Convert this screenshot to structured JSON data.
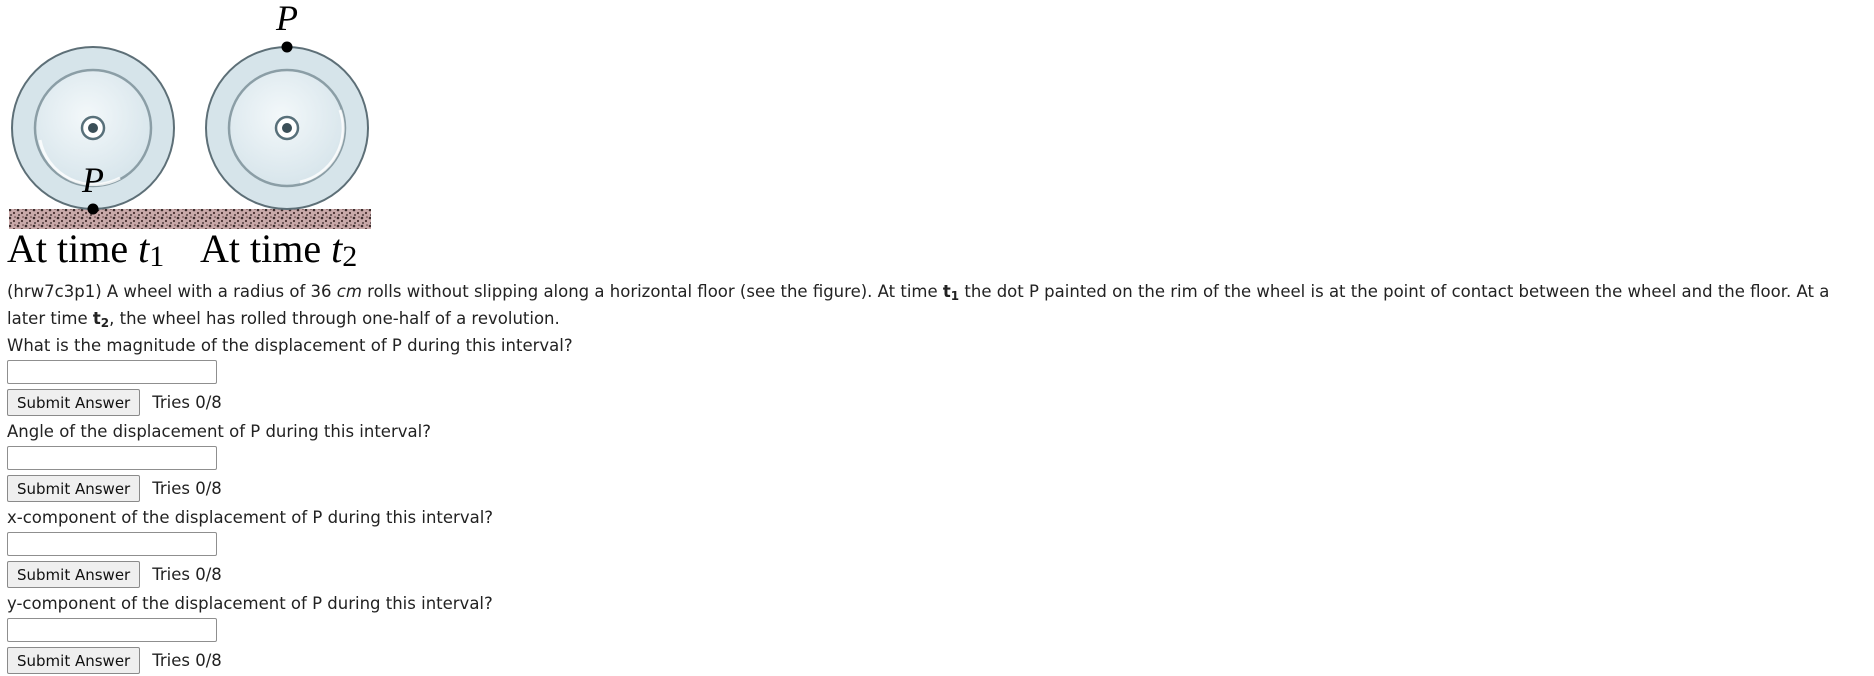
{
  "figure": {
    "point_label_t1": "P",
    "point_label_t2": "P",
    "caption_t1": "At time ",
    "caption_t1_var": "t",
    "caption_t1_sub": "1",
    "caption_t2": "At time ",
    "caption_t2_var": "t",
    "caption_t2_sub": "2"
  },
  "problem": {
    "part1": "(hrw7c3p1) A wheel with a radius of 36 ",
    "unit": "cm",
    "part2": " rolls without slipping along a horizontal floor (see the figure). At time ",
    "t1_var": "t",
    "t1_sub": "1",
    "part3": " the dot P painted on the rim of the wheel is at the point of contact between the wheel and the floor. At a later time ",
    "t2_var": "t",
    "t2_sub": "2",
    "part4": ", the wheel has rolled through one-half of a revolution."
  },
  "questions": [
    {
      "prompt": "What is the magnitude of the displacement of P during this interval?",
      "value": "",
      "button": "Submit Answer",
      "tries": "Tries 0/8"
    },
    {
      "prompt": "Angle of the displacement of P during this interval?",
      "value": "",
      "button": "Submit Answer",
      "tries": "Tries 0/8"
    },
    {
      "prompt": "x-component of the displacement of P during this interval?",
      "value": "",
      "button": "Submit Answer",
      "tries": "Tries 0/8"
    },
    {
      "prompt": "y-component of the displacement of P during this interval?",
      "value": "",
      "button": "Submit Answer",
      "tries": "Tries 0/8"
    }
  ]
}
